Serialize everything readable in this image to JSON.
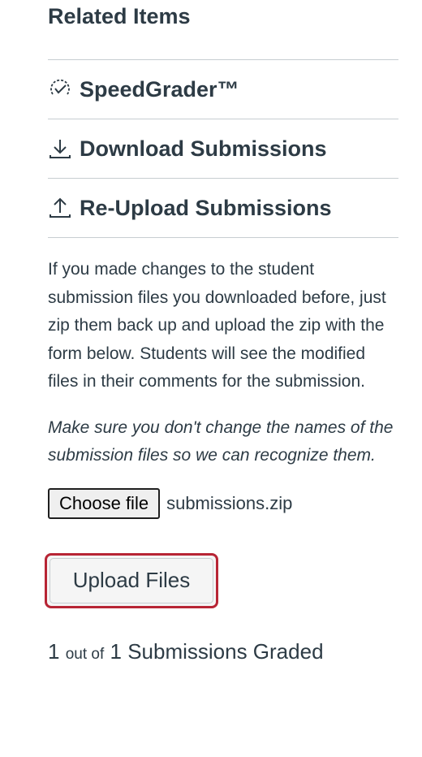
{
  "related": {
    "heading": "Related Items",
    "items": [
      {
        "label": "SpeedGrader™",
        "icon": "speedgrader-icon"
      },
      {
        "label": "Download Submissions",
        "icon": "download-icon"
      },
      {
        "label": "Re-Upload Submissions",
        "icon": "upload-icon"
      }
    ]
  },
  "reupload": {
    "help_text": "If you made changes to the student submission files you downloaded before, just zip them back up and upload the zip with the form below. Students will see the modified files in their comments for the submission.",
    "note": "Make sure you don't change the names of the submission files so we can recognize them.",
    "choose_file_label": "Choose file",
    "file_name": "submissions.zip",
    "upload_label": "Upload Files"
  },
  "graded": {
    "count": "1",
    "out_of_label": "out of",
    "total": "1",
    "suffix": "Submissions Graded"
  },
  "colors": {
    "text": "#2d3b45",
    "divider": "#c7cdd1",
    "focus_ring": "#b72535"
  }
}
